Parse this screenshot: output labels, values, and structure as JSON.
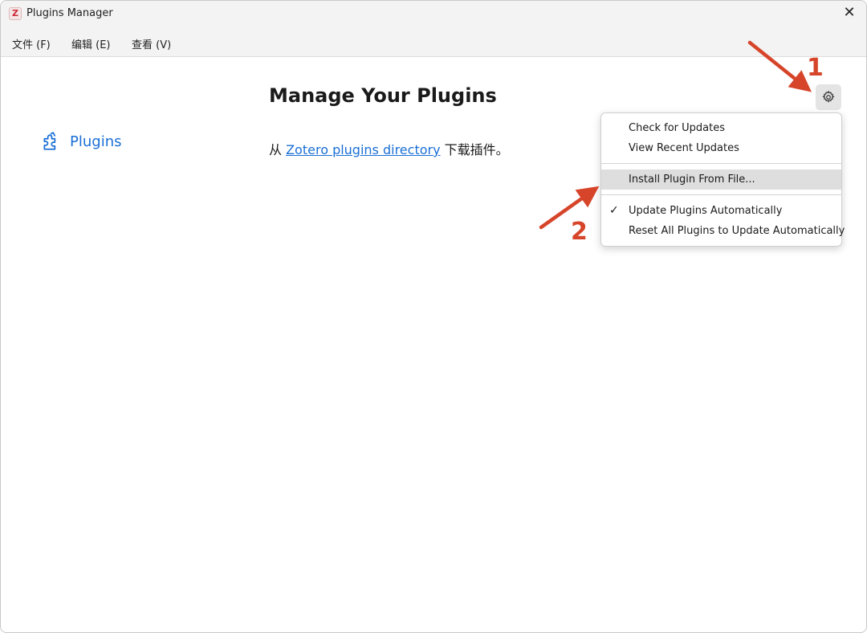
{
  "window": {
    "title": "Plugins Manager",
    "app_icon_letter": "Z",
    "close_glyph": "✕"
  },
  "menubar": {
    "items": [
      {
        "label": "文件 (F)"
      },
      {
        "label": "编辑 (E)"
      },
      {
        "label": "查看 (V)"
      }
    ]
  },
  "sidebar": {
    "items": [
      {
        "label": "Plugins",
        "icon": "puzzle-icon"
      }
    ]
  },
  "main": {
    "title": "Manage Your Plugins",
    "desc_prefix": "从 ",
    "desc_link": "Zotero plugins directory",
    "desc_suffix": " 下载插件。"
  },
  "gear_menu": {
    "icon": "gear-icon",
    "items": [
      {
        "label": "Check for Updates"
      },
      {
        "label": "View Recent Updates"
      },
      {
        "label": "Install Plugin From File..."
      },
      {
        "label": "Update Plugins Automatically",
        "checked": true
      },
      {
        "label": "Reset All Plugins to Update Automatically"
      }
    ]
  },
  "annotations": {
    "step1": "1",
    "step2": "2"
  },
  "colors": {
    "accent": "#1a6fd6",
    "annotation": "#d6452a",
    "highlight": "#dedede"
  }
}
